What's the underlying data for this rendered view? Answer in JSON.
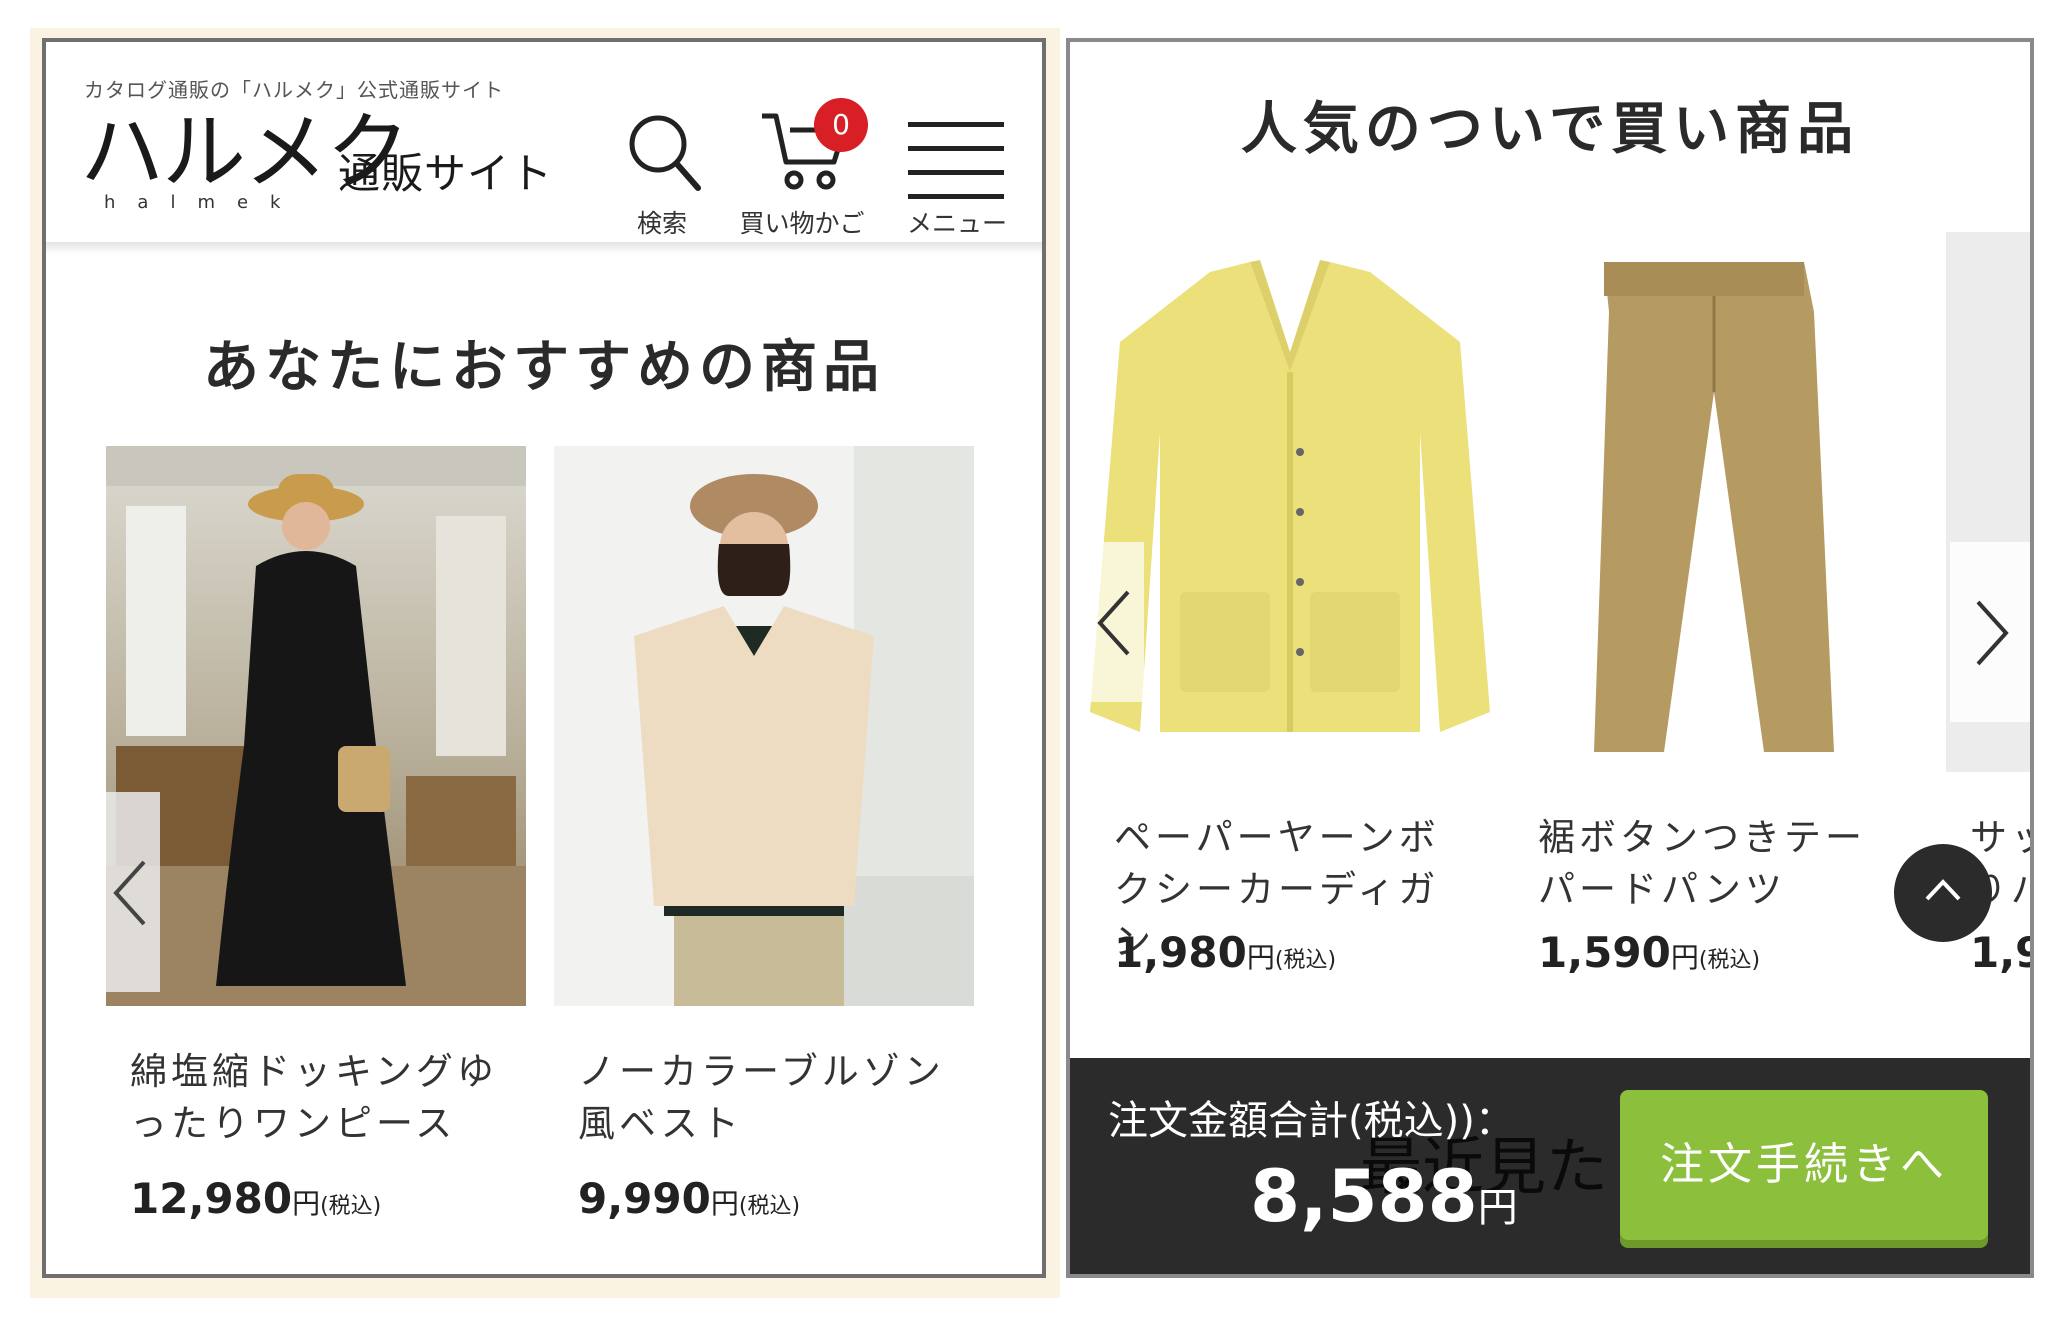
{
  "left": {
    "header": {
      "tagline": "カタログ通販の「ハルメク」公式通販サイト",
      "logo_main": "ハルメク",
      "logo_sub": "通販サイト",
      "logo_roman": "halmek",
      "search_label": "検索",
      "cart_label": "買い物かご",
      "cart_count": "0",
      "menu_label": "メニュー"
    },
    "section_title": "あなたにおすすめの商品",
    "products": [
      {
        "name": "綿塩縮ドッキングゆったりワンピース",
        "price": "12,980",
        "yen": "円",
        "tax": "(税込)"
      },
      {
        "name": "ノーカラーブルゾン風ベスト",
        "price": "9,990",
        "yen": "円",
        "tax": "(税込)"
      }
    ]
  },
  "right": {
    "section_title": "人気のついで買い商品",
    "products": [
      {
        "name": "ペーパーヤーンボクシーカーディガン",
        "price": "1,980",
        "yen": "円",
        "tax": "(税込)"
      },
      {
        "name": "裾ボタンつきテーパードパンツ",
        "price": "1,590",
        "yen": "円",
        "tax": "(税込)"
      },
      {
        "name": "サッ",
        "name2": "りパ",
        "price": "1,9"
      }
    ],
    "order_bar": {
      "label": "注文金額合計(税込))：",
      "total": "8,588",
      "yen": "円",
      "ghost_text": "最近見た",
      "checkout_label": "注文手続きへ"
    }
  },
  "colors": {
    "accent_green": "#8bbf3c",
    "badge_red": "#d81f26",
    "order_bar_bg": "#2b2b2b",
    "frame_cream": "#fbf3e2"
  },
  "icons": [
    "search-icon",
    "cart-icon",
    "hamburger-menu-icon",
    "chevron-left-icon",
    "chevron-right-icon",
    "chevron-up-icon"
  ]
}
